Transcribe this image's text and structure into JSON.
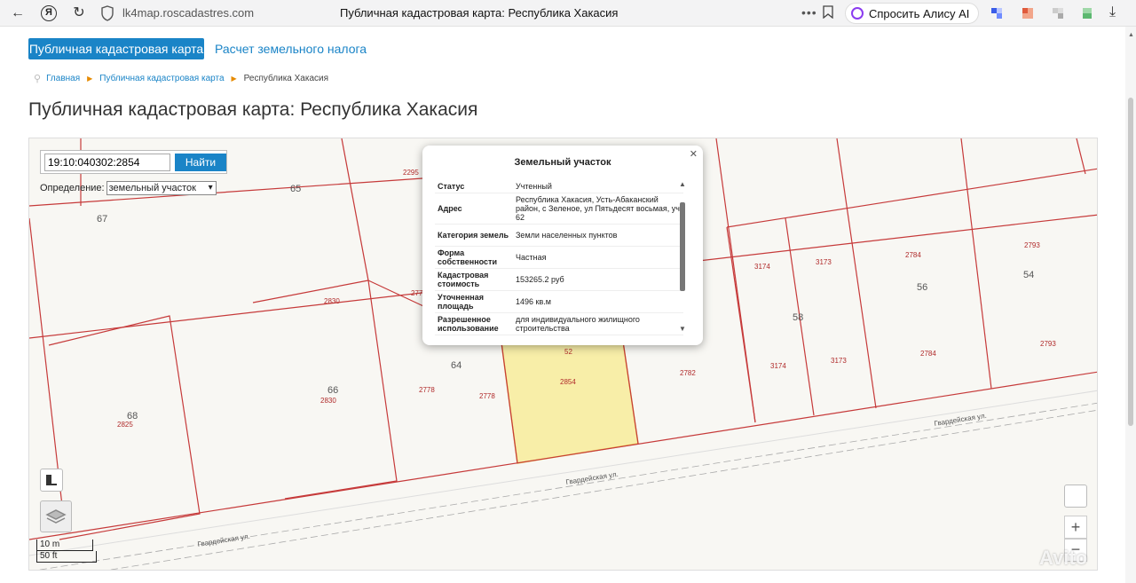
{
  "browser": {
    "url": "lk4map.roscadastres.com",
    "tab_title": "Публичная кадастровая карта: Республика Хакасия",
    "alice_label": "Спросить Алису AI"
  },
  "header": {
    "tab_active": "Публичная кадастровая карта",
    "tab_link": "Расчет земельного налога"
  },
  "breadcrumb": {
    "home": "Главная",
    "map": "Публичная кадастровая карта",
    "current": "Республика Хакасия"
  },
  "page_title": "Публичная кадастровая карта: Республика Хакасия",
  "map": {
    "search_value": "19:10:040302:2854",
    "search_button": "Найти",
    "definition_label": "Определение:",
    "definition_value": "земельный участок",
    "scale_metric": "10 m",
    "scale_imperial": "50 ft",
    "zoom_in": "+",
    "zoom_out": "−",
    "watermark": "Avito",
    "street_name": "Гвардейская ул.",
    "house_numbers": [
      "65",
      "67",
      "66",
      "68",
      "64",
      "58",
      "56",
      "54"
    ],
    "parcel_labels": [
      "2295",
      "2830",
      "2830",
      "2825",
      "2778",
      "2778",
      "2854",
      "2782",
      "3174",
      "3173",
      "3174",
      "3173",
      "2784",
      "2784",
      "2793",
      "2793",
      "277",
      "52"
    ]
  },
  "popup": {
    "title": "Земельный участок",
    "rows": [
      {
        "key": "Статус",
        "value": "Учтенный"
      },
      {
        "key": "Адрес",
        "value": "Республика Хакасия, Усть-Абаканский район, с Зеленое, ул Пятьдесят восьмая, уч 62"
      },
      {
        "key": "Категория земель",
        "value": "Земли населенных пунктов"
      },
      {
        "key": "Форма собственности",
        "value": "Частная"
      },
      {
        "key": "Кадастровая стоимость",
        "value": "153265.2 руб"
      },
      {
        "key": "Уточненная площадь",
        "value": "1496 кв.м"
      },
      {
        "key": "Разрешенное использование",
        "value": "для индивидуального жилищного строительства"
      }
    ]
  }
}
